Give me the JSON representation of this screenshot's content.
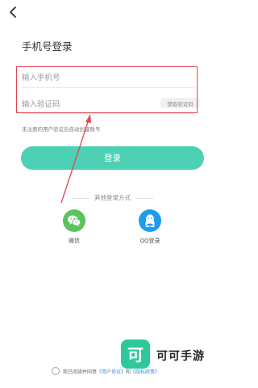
{
  "nav": {
    "back_icon": "chevron-left-icon"
  },
  "title": "手机号登录",
  "phone": {
    "placeholder": "输入手机号"
  },
  "code": {
    "placeholder": "输入验证码",
    "get_code_label": "获取验证码"
  },
  "hint": "未注册的用户验证后自动创建账号",
  "login_label": "登录",
  "other_login": {
    "title": "其他登录方式",
    "wechat": {
      "label": "微信",
      "icon": "wechat-icon",
      "color": "#5ac35e"
    },
    "qq": {
      "label": "QQ登录",
      "icon": "qq-icon",
      "color": "#1c9bef"
    }
  },
  "agreement": {
    "prefix": "我已阅读并同意",
    "user_agreement": "《用户协议》",
    "and": "和",
    "privacy_policy": "《隐私政策》"
  },
  "watermark": {
    "text": "可可手游",
    "icon_glyph": "可",
    "color": "#2ec99a"
  },
  "colors": {
    "accent": "#4ed0b4",
    "highlight": "#e0484e"
  }
}
